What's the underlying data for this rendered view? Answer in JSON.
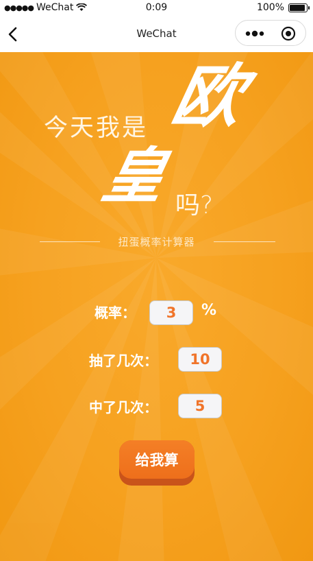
{
  "status_bar": {
    "carrier": "WeChat",
    "time": "0:09",
    "battery": "100%",
    "battery_level": 1.0
  },
  "nav": {
    "title": "WeChat",
    "icons": [
      "back-icon",
      "more-icon",
      "close-icon"
    ]
  },
  "hero": {
    "line1": "今天我是",
    "big1": "欧",
    "big2": "皇",
    "line2": "吗?",
    "subtitle": "扭蛋概率计算器"
  },
  "form": {
    "probability_label": "概率：",
    "probability_value": "3",
    "probability_unit": "%",
    "draws_label": "抽了几次：",
    "draws_value": "10",
    "hits_label": "中了几次：",
    "hits_value": "5"
  },
  "button": {
    "label": "给我算"
  },
  "colors": {
    "background_orange": "#f6a11f",
    "button_orange": "#ef7420",
    "button_shadow": "#c9531a",
    "input_text": "#f0742a"
  }
}
